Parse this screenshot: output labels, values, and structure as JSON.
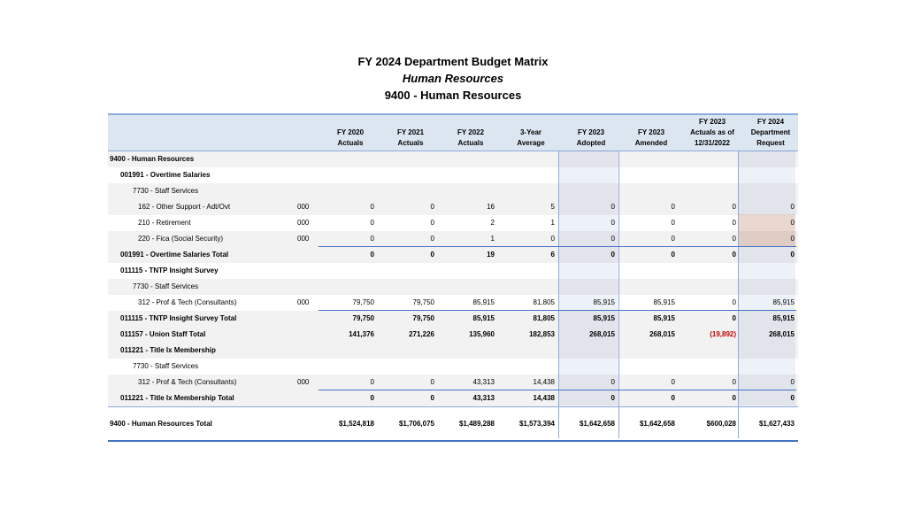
{
  "title": "FY 2024 Department Budget Matrix",
  "subtitle": "Human Resources",
  "dept_line": "9400 - Human Resources",
  "columns": [
    {
      "line1": "FY 2020",
      "line2": "Actuals",
      "line3": ""
    },
    {
      "line1": "FY 2021",
      "line2": "Actuals",
      "line3": ""
    },
    {
      "line1": "FY 2022",
      "line2": "Actuals",
      "line3": ""
    },
    {
      "line1": "3-Year",
      "line2": "Average",
      "line3": ""
    },
    {
      "line1": "FY 2023",
      "line2": "Adopted",
      "line3": ""
    },
    {
      "line1": "FY 2023",
      "line2": "Amended",
      "line3": ""
    },
    {
      "line1": "FY 2023",
      "line2": "Actuals as of",
      "line3": "12/31/2022"
    },
    {
      "line1": "FY 2024",
      "line2": "Department",
      "line3": "Request"
    }
  ],
  "rows": [
    {
      "label": "9400 - Human Resources",
      "level": 0,
      "bold": true,
      "code": "",
      "values": [
        "",
        "",
        "",
        "",
        "",
        "",
        "",
        ""
      ]
    },
    {
      "label": "001991 - Overtime Salaries",
      "level": 1,
      "bold": true,
      "code": "",
      "values": [
        "",
        "",
        "",
        "",
        "",
        "",
        "",
        ""
      ]
    },
    {
      "label": "7730 - Staff Services",
      "level": 2,
      "bold": false,
      "code": "",
      "values": [
        "",
        "",
        "",
        "",
        "",
        "",
        "",
        ""
      ]
    },
    {
      "label": "162 - Other Support - Adt/Ovt",
      "level": 3,
      "bold": false,
      "code": "000",
      "values": [
        "0",
        "0",
        "16",
        "5",
        "0",
        "0",
        "0",
        "0"
      ]
    },
    {
      "label": "210 - Retirement",
      "level": 3,
      "bold": false,
      "code": "000",
      "values": [
        "0",
        "0",
        "2",
        "1",
        "0",
        "0",
        "0",
        "0"
      ]
    },
    {
      "label": "220 - Fica (Social Security)",
      "level": 3,
      "bold": false,
      "code": "000",
      "values": [
        "0",
        "0",
        "1",
        "0",
        "0",
        "0",
        "0",
        "0"
      ]
    },
    {
      "label": "001991 - Overtime Salaries Total",
      "level": 1,
      "bold": true,
      "code": "",
      "values": [
        "0",
        "0",
        "19",
        "6",
        "0",
        "0",
        "0",
        "0"
      ]
    },
    {
      "label": "011115 - TNTP Insight Survey",
      "level": 1,
      "bold": true,
      "code": "",
      "values": [
        "",
        "",
        "",
        "",
        "",
        "",
        "",
        ""
      ]
    },
    {
      "label": "7730 - Staff Services",
      "level": 2,
      "bold": false,
      "code": "",
      "values": [
        "",
        "",
        "",
        "",
        "",
        "",
        "",
        ""
      ]
    },
    {
      "label": "312 - Prof & Tech (Consultants)",
      "level": 3,
      "bold": false,
      "code": "000",
      "values": [
        "79,750",
        "79,750",
        "85,915",
        "81,805",
        "85,915",
        "85,915",
        "0",
        "85,915"
      ]
    },
    {
      "label": "011115 - TNTP Insight Survey Total",
      "level": 1,
      "bold": true,
      "code": "",
      "values": [
        "79,750",
        "79,750",
        "85,915",
        "81,805",
        "85,915",
        "85,915",
        "0",
        "85,915"
      ]
    },
    {
      "label": "011157 - Union Staff Total",
      "level": 1,
      "bold": true,
      "code": "",
      "values": [
        "141,376",
        "271,226",
        "135,960",
        "182,853",
        "268,015",
        "268,015",
        "(19,892)",
        "268,015"
      ]
    },
    {
      "label": "011221 - Title Ix Membership",
      "level": 1,
      "bold": true,
      "code": "",
      "values": [
        "",
        "",
        "",
        "",
        "",
        "",
        "",
        ""
      ]
    },
    {
      "label": "7730 - Staff Services",
      "level": 2,
      "bold": false,
      "code": "",
      "values": [
        "",
        "",
        "",
        "",
        "",
        "",
        "",
        ""
      ]
    },
    {
      "label": "312 - Prof & Tech (Consultants)",
      "level": 3,
      "bold": false,
      "code": "000",
      "values": [
        "0",
        "0",
        "43,313",
        "14,438",
        "0",
        "0",
        "0",
        "0"
      ]
    },
    {
      "label": "011221 - Title Ix Membership Total",
      "level": 1,
      "bold": true,
      "code": "",
      "values": [
        "0",
        "0",
        "43,313",
        "14,438",
        "0",
        "0",
        "0",
        "0"
      ]
    }
  ],
  "grand_total": {
    "label": "9400 - Human Resources Total",
    "values": [
      "$1,524,818",
      "$1,706,075",
      "$1,489,288",
      "$1,573,394",
      "$1,642,658",
      "$1,642,658",
      "$600,028",
      "$1,627,433"
    ]
  },
  "colors": {
    "header_fill": "#dce6f1",
    "shaded_row": "#f2f2f2",
    "column_highlight": "#edf2f8",
    "request_highlight": "#fce4d6",
    "negative": "#c00000",
    "rule": "#4472c4"
  }
}
